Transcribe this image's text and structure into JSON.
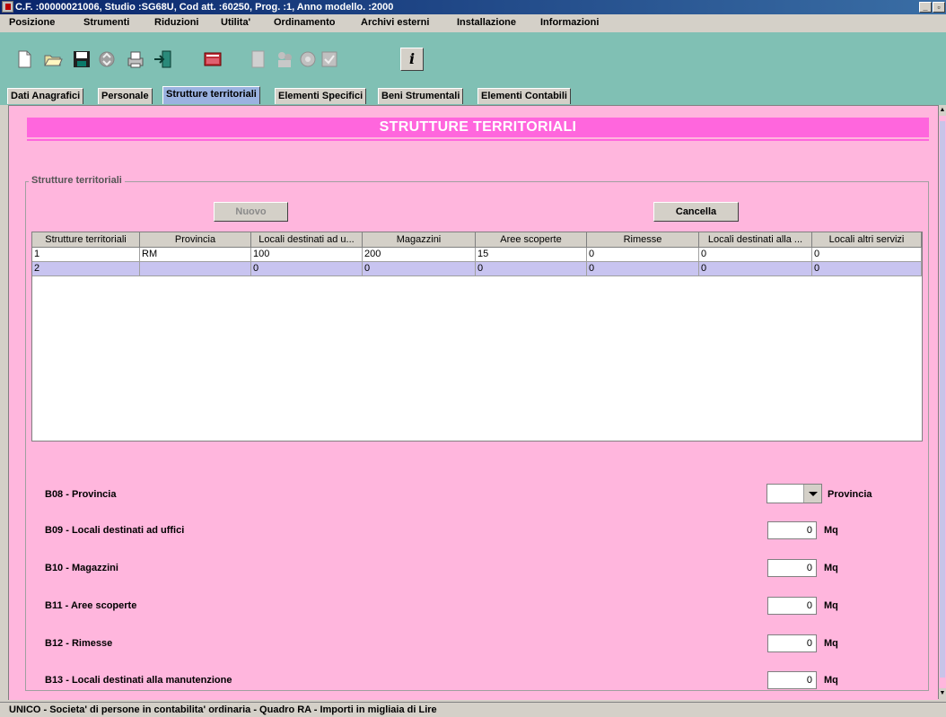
{
  "window": {
    "title": "C.F. :00000021006, Studio :SG68U, Cod att. :60250, Prog. :1, Anno modello. :2000",
    "minimize_glyph": "_",
    "maximize_glyph": "▫"
  },
  "menu": {
    "items": [
      "Posizione",
      "Strumenti",
      "Riduzioni",
      "Utilita'",
      "Ordinamento",
      "Archivi esterni",
      "Installazione",
      "Informazioni"
    ]
  },
  "toolbar": {
    "icons": [
      "new-document-icon",
      "open-folder-icon",
      "save-disk-icon",
      "recycle-icon",
      "print-icon",
      "exit-door-icon",
      "calculator-icon",
      "copy-document-icon",
      "people-icon",
      "globe-icon",
      "check-icon",
      "info-icon"
    ],
    "info_glyph": "i"
  },
  "tabs": [
    "Dati Anagrafici",
    "Personale",
    "Strutture territoriali",
    "Elementi Specifici",
    "Beni Strumentali",
    "Elementi Contabili"
  ],
  "active_tab": "Strutture territoriali",
  "banner": {
    "title": "STRUTTURE TERRITORIALI"
  },
  "group": {
    "legend": "Strutture territoriali",
    "nuovo_label": "Nuovo",
    "cancella_label": "Cancella"
  },
  "table": {
    "columns": [
      "Strutture territoriali",
      "Provincia",
      "Locali destinati ad u...",
      "Magazzini",
      "Aree scoperte",
      "Rimesse",
      "Locali destinati alla ...",
      "Locali altri servizi"
    ],
    "rows": [
      [
        "1",
        "RM",
        "100",
        "200",
        "15",
        "0",
        "0",
        "0"
      ],
      [
        "2",
        "",
        "0",
        "0",
        "0",
        "0",
        "0",
        "0"
      ]
    ],
    "selected_row": 1
  },
  "form": {
    "provincia": {
      "label": "B08 - Provincia",
      "value": "",
      "unit": "Provincia"
    },
    "fields": [
      {
        "label": "B09 - Locali destinati ad uffici",
        "value": "0",
        "unit": "Mq"
      },
      {
        "label": "B10 - Magazzini",
        "value": "0",
        "unit": "Mq"
      },
      {
        "label": "B11 - Aree scoperte",
        "value": "0",
        "unit": "Mq"
      },
      {
        "label": "B12 - Rimesse",
        "value": "0",
        "unit": "Mq"
      },
      {
        "label": "B13 - Locali destinati alla manutenzione",
        "value": "0",
        "unit": "Mq"
      }
    ]
  },
  "status": {
    "text": "UNICO - Societa' di persone in contabilita' ordinaria - Quadro RA - Importi in migliaia di Lire"
  },
  "colors": {
    "content_bg": "#ffb6dd",
    "banner_bg": "#ff66dd",
    "toolbar_bg": "#80c0b4",
    "active_tab_bg": "#9ab2e0",
    "selected_row_bg": "#c8c4f0"
  }
}
